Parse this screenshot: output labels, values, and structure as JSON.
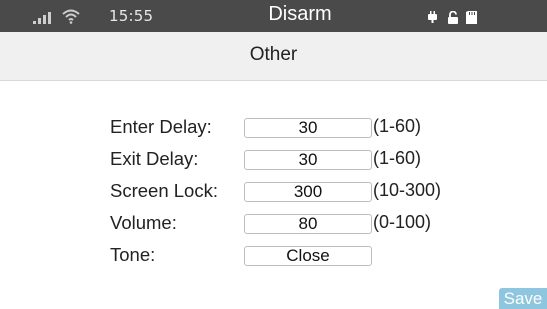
{
  "status_bar": {
    "time": "15:55",
    "mode": "Disarm",
    "icons": [
      "signal-icon",
      "wifi-icon",
      "power-plug-icon",
      "unlocked-padlock-icon",
      "sd-card-icon"
    ]
  },
  "header": {
    "title": "Other"
  },
  "settings": [
    {
      "label": "Enter Delay:",
      "value": "30",
      "range": "(1-60)"
    },
    {
      "label": "Exit Delay:",
      "value": "30",
      "range": "(1-60)"
    },
    {
      "label": "Screen Lock:",
      "value": "300",
      "range": "(10-300)"
    },
    {
      "label": "Volume:",
      "value": "80",
      "range": "(0-100)"
    },
    {
      "label": "Tone:",
      "value": "Close",
      "range": ""
    }
  ],
  "actions": {
    "save_label": "Save"
  },
  "colors": {
    "status_bar_bg": "#4a4a4a",
    "title_bar_bg": "#f0f0f0",
    "save_button_bg": "#8ec6df"
  }
}
